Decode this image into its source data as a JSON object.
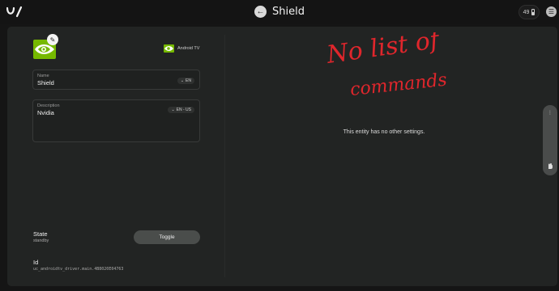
{
  "header": {
    "title": "Shield",
    "battery_level": "49"
  },
  "entity": {
    "platform_label": "Android TV",
    "name_field": {
      "label": "Name",
      "value": "Shield",
      "lang": "EN"
    },
    "description_field": {
      "label": "Description",
      "value": "Nvidia",
      "lang": "EN - US"
    },
    "state": {
      "label": "State",
      "value": "standby",
      "action_label": "Toggle"
    },
    "id": {
      "label": "Id",
      "value": "uc_androidtv_driver.main.4B8020E04763"
    }
  },
  "settings": {
    "empty_message": "This entity has no other settings."
  },
  "annotation": {
    "line1": "No list of",
    "line2": "commands"
  },
  "colors": {
    "accent_green": "#76b900",
    "annotation_red": "#e0262c",
    "panel_bg": "#222423"
  }
}
